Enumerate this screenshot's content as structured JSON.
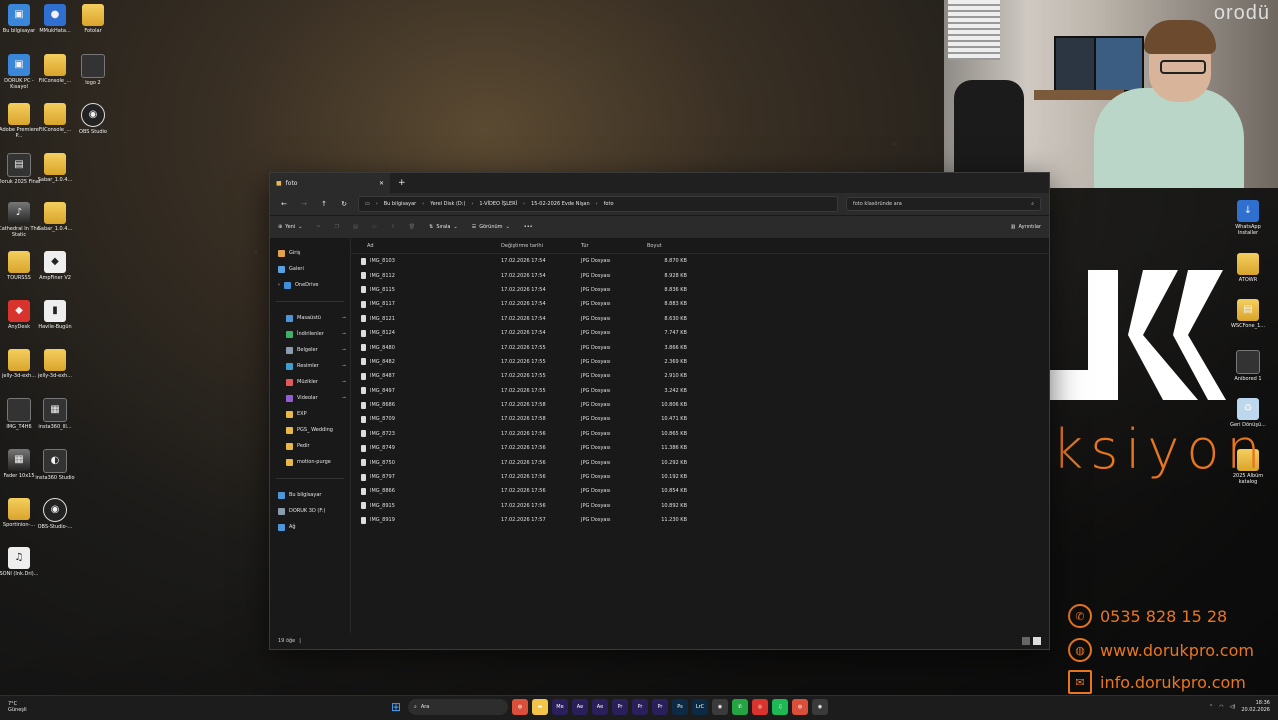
{
  "desktop_icons": [
    {
      "label": "Bu bilgisayar",
      "glyph": "▣",
      "style": "g-pc"
    },
    {
      "label": "MMukHata...",
      "glyph": "●",
      "style": "g-blue"
    },
    {
      "label": "Fotolar",
      "glyph": "",
      "style": "g-folder"
    },
    {
      "label": "DORUK PC - Kısayol",
      "glyph": "▣",
      "style": "g-pc"
    },
    {
      "label": "FilConsole_...",
      "glyph": "",
      "style": "g-folder"
    },
    {
      "label": "logo 2",
      "glyph": "",
      "style": "g-dark"
    },
    {
      "label": "Adobe Premiere P...",
      "glyph": "",
      "style": "g-folder"
    },
    {
      "label": "FilConsole_...",
      "glyph": "",
      "style": "g-folder"
    },
    {
      "label": "OBS Studio",
      "glyph": "◉",
      "style": "g-obs"
    },
    {
      "label": "Doruk 2025 Final",
      "glyph": "▤",
      "style": "g-dark"
    },
    {
      "label": "Sabar_1.0.4...",
      "glyph": "",
      "style": "g-folder"
    },
    {
      "label": "Cathedral In The Static",
      "glyph": "♪",
      "style": "g-img"
    },
    {
      "label": "Sabar_1.0.4...",
      "glyph": "",
      "style": "g-folder"
    },
    {
      "label": "TOURSSS",
      "glyph": "",
      "style": "g-folder"
    },
    {
      "label": "AmpFiner V2",
      "glyph": "◆",
      "style": "g-white"
    },
    {
      "label": "AnyDesk",
      "glyph": "◆",
      "style": "g-red"
    },
    {
      "label": "Havile-Bugün",
      "glyph": "▮",
      "style": "g-white"
    },
    {
      "label": "jelly-3d-exh...",
      "glyph": "",
      "style": "g-folder"
    },
    {
      "label": "jelly-3d-exh...",
      "glyph": "",
      "style": "g-folder"
    },
    {
      "label": "IMG_T4H6",
      "glyph": "",
      "style": "g-dark"
    },
    {
      "label": "insta360_lll...",
      "glyph": "▦",
      "style": "g-dark"
    },
    {
      "label": "Fader 10x15",
      "glyph": "▦",
      "style": "g-img"
    },
    {
      "label": "insta360 Studio",
      "glyph": "◐",
      "style": "g-dark"
    },
    {
      "label": "Sportinion-...",
      "glyph": "",
      "style": "g-folder"
    },
    {
      "label": "OBS-Studio-...",
      "glyph": "◉",
      "style": "g-obs"
    },
    {
      "label": "SONI (Ink.Dri)...",
      "glyph": "♫",
      "style": "g-white"
    }
  ],
  "right_icons": [
    {
      "label": "WhatsApp Installer",
      "glyph": "↓",
      "style": "g-blue"
    },
    {
      "label": "ATOWR",
      "glyph": "",
      "style": "g-folder"
    },
    {
      "label": "WSCFone_1...",
      "glyph": "▤",
      "style": "g-folder"
    },
    {
      "label": "Anibored 1",
      "glyph": "",
      "style": "g-dark"
    },
    {
      "label": "Geri Dönüşü...",
      "glyph": "♻",
      "style": "g-recycle"
    },
    {
      "label": "2025 Albüm katalog",
      "glyph": "",
      "style": "g-folder"
    }
  ],
  "webcam": {
    "brand": "orodü"
  },
  "watermark": {
    "word": "ksiyon",
    "phone": "0535 828 15 28",
    "web": "www.dorukpro.com",
    "email": "info.dorukpro.com"
  },
  "explorer": {
    "tab_title": "foto",
    "tab_close": "✕",
    "new_tab": "+",
    "breadcrumb": [
      "Bu bilgisayar",
      "Yerel Disk (D:)",
      "1-VİDEO İŞLERİ",
      "15-02-2026 Evde Nişan",
      "foto"
    ],
    "search_placeholder": "foto klasöründe ara",
    "commands": {
      "new": "Yeni",
      "sort": "Sırala",
      "view": "Görünüm",
      "more": "•••",
      "details": "Ayrıntılar"
    },
    "nav": {
      "top": [
        {
          "label": "Giriş",
          "color": "#e0a050"
        },
        {
          "label": "Galeri",
          "color": "#5aa0e0"
        },
        {
          "label": "OneDrive",
          "color": "#3f8fdc"
        }
      ],
      "pinned": [
        {
          "label": "Masaüstü",
          "color": "#4f96d9"
        },
        {
          "label": "İndirilenler",
          "color": "#3fb06a"
        },
        {
          "label": "Belgeler",
          "color": "#8a9db0"
        },
        {
          "label": "Resimler",
          "color": "#3fa0d0"
        },
        {
          "label": "Müzikler",
          "color": "#e05a5a"
        },
        {
          "label": "Videolar",
          "color": "#9060d0"
        },
        {
          "label": "EXP",
          "color": "#e9b84a"
        },
        {
          "label": "PGS_ Wedding",
          "color": "#e9b84a"
        },
        {
          "label": "Pedir",
          "color": "#e9b84a"
        },
        {
          "label": "motion-purge",
          "color": "#e9b84a"
        }
      ],
      "bottom": [
        {
          "label": "Bu bilgisayar",
          "color": "#4f96d9"
        },
        {
          "label": "DORUK 3D (F:)",
          "color": "#8a9db0"
        },
        {
          "label": "Ağ",
          "color": "#4f96d9"
        }
      ]
    },
    "columns": {
      "name": "Ad",
      "date": "Değiştirme tarihi",
      "type": "Tür",
      "size": "Boyut"
    },
    "files": [
      {
        "name": "IMG_8103",
        "date": "17.02.2026 17:54",
        "type": "JPG Dosyası",
        "size": "8.870 KB"
      },
      {
        "name": "IMG_8112",
        "date": "17.02.2026 17:54",
        "type": "JPG Dosyası",
        "size": "8.928 KB"
      },
      {
        "name": "IMG_8115",
        "date": "17.02.2026 17:54",
        "type": "JPG Dosyası",
        "size": "8.836 KB"
      },
      {
        "name": "IMG_8117",
        "date": "17.02.2026 17:54",
        "type": "JPG Dosyası",
        "size": "8.883 KB"
      },
      {
        "name": "IMG_8121",
        "date": "17.02.2026 17:54",
        "type": "JPG Dosyası",
        "size": "8.630 KB"
      },
      {
        "name": "IMG_8124",
        "date": "17.02.2026 17:54",
        "type": "JPG Dosyası",
        "size": "7.747 KB"
      },
      {
        "name": "IMG_8480",
        "date": "17.02.2026 17:55",
        "type": "JPG Dosyası",
        "size": "3.866 KB"
      },
      {
        "name": "IMG_8482",
        "date": "17.02.2026 17:55",
        "type": "JPG Dosyası",
        "size": "2.369 KB"
      },
      {
        "name": "IMG_8487",
        "date": "17.02.2026 17:55",
        "type": "JPG Dosyası",
        "size": "2.910 KB"
      },
      {
        "name": "IMG_8497",
        "date": "17.02.2026 17:55",
        "type": "JPG Dosyası",
        "size": "3.242 KB"
      },
      {
        "name": "IMG_8686",
        "date": "17.02.2026 17:58",
        "type": "JPG Dosyası",
        "size": "10.806 KB"
      },
      {
        "name": "IMG_8709",
        "date": "17.02.2026 17:58",
        "type": "JPG Dosyası",
        "size": "10.471 KB"
      },
      {
        "name": "IMG_8723",
        "date": "17.02.2026 17:56",
        "type": "JPG Dosyası",
        "size": "10.865 KB"
      },
      {
        "name": "IMG_8749",
        "date": "17.02.2026 17:56",
        "type": "JPG Dosyası",
        "size": "11.386 KB"
      },
      {
        "name": "IMG_8750",
        "date": "17.02.2026 17:56",
        "type": "JPG Dosyası",
        "size": "10.292 KB"
      },
      {
        "name": "IMG_8797",
        "date": "17.02.2026 17:56",
        "type": "JPG Dosyası",
        "size": "10.192 KB"
      },
      {
        "name": "IMG_8866",
        "date": "17.02.2026 17:56",
        "type": "JPG Dosyası",
        "size": "10.854 KB"
      },
      {
        "name": "IMG_8915",
        "date": "17.02.2026 17:56",
        "type": "JPG Dosyası",
        "size": "10.892 KB"
      },
      {
        "name": "IMG_8919",
        "date": "17.02.2026 17:57",
        "type": "JPG Dosyası",
        "size": "11.230 KB"
      }
    ],
    "status_count": "19 öğe"
  },
  "taskbar": {
    "weather_temp": "7°C",
    "weather_desc": "Güneşli",
    "search_text": "Ara",
    "apps": [
      {
        "glyph": "◍",
        "bg": "#d94f3a"
      },
      {
        "glyph": "▬",
        "bg": "#f3c34a"
      },
      {
        "glyph": "Me",
        "bg": "#2a1f5a"
      },
      {
        "glyph": "Ae",
        "bg": "#2a1f5a"
      },
      {
        "glyph": "Ae",
        "bg": "#2a1f5a"
      },
      {
        "glyph": "Pr",
        "bg": "#2a1f5a"
      },
      {
        "glyph": "Pr",
        "bg": "#2a1f5a"
      },
      {
        "glyph": "Pr",
        "bg": "#2a1f5a"
      },
      {
        "glyph": "Ps",
        "bg": "#0c2a44"
      },
      {
        "glyph": "LrC",
        "bg": "#0c2a44"
      },
      {
        "glyph": "◉",
        "bg": "#3a3a3a"
      },
      {
        "glyph": "✆",
        "bg": "#25a444"
      },
      {
        "glyph": "◎",
        "bg": "#d9332e"
      },
      {
        "glyph": "♫",
        "bg": "#1db954"
      },
      {
        "glyph": "◍",
        "bg": "#d94f3a"
      },
      {
        "glyph": "◉",
        "bg": "#3a3a3a"
      }
    ],
    "time": "18:36",
    "date": "20.02.2026"
  }
}
